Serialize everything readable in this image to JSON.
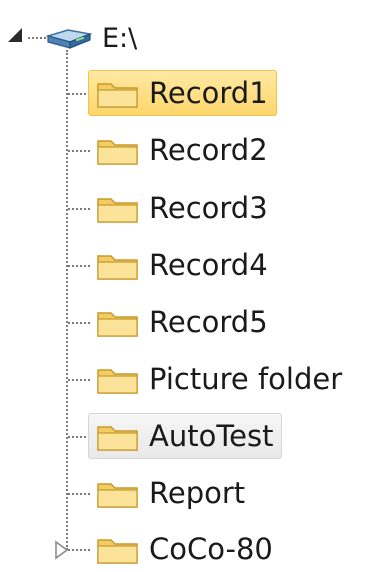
{
  "tree": {
    "root": {
      "label": "E:\\",
      "icon": "drive-icon",
      "expanded": true
    },
    "items": [
      {
        "label": "Record1",
        "icon": "folder-icon",
        "state": "selected"
      },
      {
        "label": "Record2",
        "icon": "folder-icon",
        "state": "normal"
      },
      {
        "label": "Record3",
        "icon": "folder-icon",
        "state": "normal"
      },
      {
        "label": "Record4",
        "icon": "folder-icon",
        "state": "normal"
      },
      {
        "label": "Record5",
        "icon": "folder-icon",
        "state": "normal"
      },
      {
        "label": "Picture folder",
        "icon": "folder-icon",
        "state": "normal"
      },
      {
        "label": "AutoTest",
        "icon": "folder-icon",
        "state": "hover"
      },
      {
        "label": "Report",
        "icon": "folder-icon",
        "state": "normal"
      },
      {
        "label": "CoCo-80",
        "icon": "folder-icon",
        "state": "normal",
        "collapsed_children": true
      }
    ]
  },
  "colors": {
    "selected_bg": "#fdd66b",
    "selected_border": "#f0c14b",
    "hover_bg": "#e9e9e9",
    "folder": "#f5d16a",
    "connector": "#7a7a7a"
  }
}
